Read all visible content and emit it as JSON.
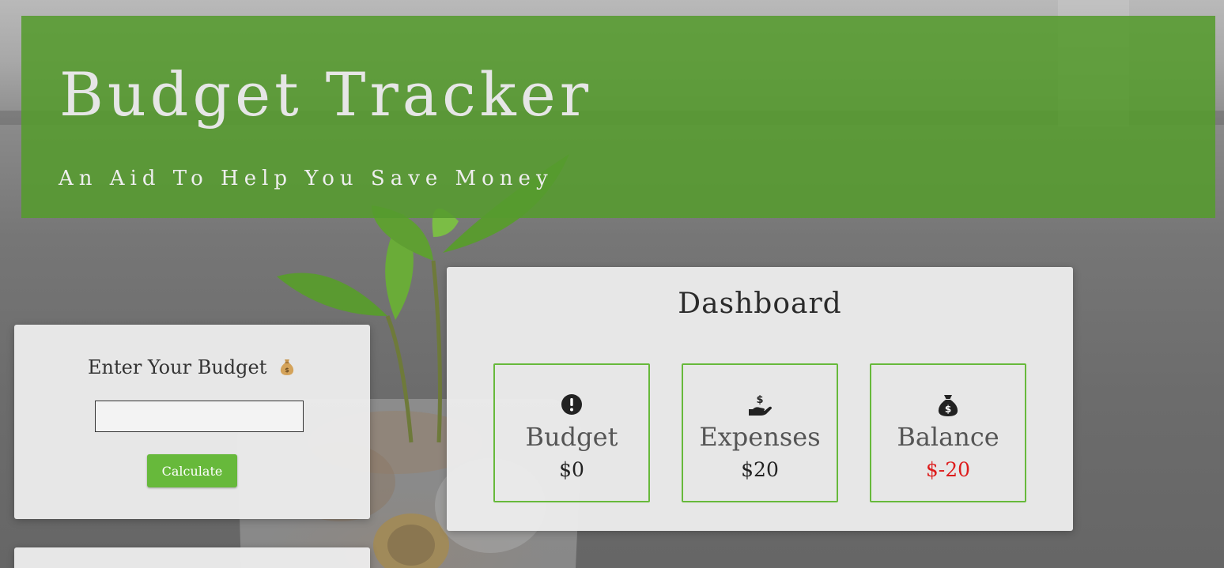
{
  "header": {
    "title": "Budget Tracker",
    "subtitle": "An Aid To Help You Save Money"
  },
  "budget_form": {
    "title": "Enter Your Budget",
    "title_icon": "money-bag-emoji",
    "input_value": "",
    "button_label": "Calculate"
  },
  "dashboard": {
    "title": "Dashboard",
    "stats": [
      {
        "label": "Budget",
        "value": "$0",
        "icon": "exclamation-circle-icon"
      },
      {
        "label": "Expenses",
        "value": "$20",
        "icon": "hand-dollar-icon"
      },
      {
        "label": "Balance",
        "value": "$-20",
        "icon": "money-bag-icon",
        "value_color": "#dd1c1c"
      }
    ]
  },
  "colors": {
    "header_bg": "#559b2d",
    "accent": "#67b93b",
    "negative": "#dd1c1c"
  }
}
